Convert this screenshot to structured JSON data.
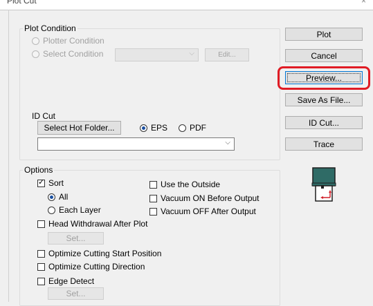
{
  "window": {
    "title": "Plot Cut",
    "close_glyph": "×"
  },
  "plot_condition": {
    "legend": "Plot Condition",
    "plotter_condition_label": "Plotter Condition",
    "select_condition_label": "Select Condition",
    "edit_label": "Edit..."
  },
  "id_cut": {
    "legend": "ID Cut",
    "select_hot_folder_label": "Select Hot Folder...",
    "eps_label": "EPS",
    "pdf_label": "PDF",
    "folder_value": ""
  },
  "options": {
    "legend": "Options",
    "sort_label": "Sort",
    "all_label": "All",
    "each_layer_label": "Each Layer",
    "head_withdrawal_label": "Head Withdrawal After Plot",
    "set_label_1": "Set...",
    "optimize_start_label": "Optimize Cutting Start Position",
    "optimize_direction_label": "Optimize Cutting Direction",
    "edge_detect_label": "Edge Detect",
    "set_label_2": "Set...",
    "use_outside_label": "Use the Outside",
    "vacuum_on_label": "Vacuum ON Before Output",
    "vacuum_off_label": "Vacuum OFF After Output"
  },
  "actions": {
    "plot_label": "Plot",
    "cancel_label": "Cancel",
    "preview_label": "Preview...",
    "save_as_file_label": "Save As File...",
    "id_cut_label": "ID Cut...",
    "trace_label": "Trace"
  },
  "colors": {
    "highlight": "#e01b24",
    "icon_teal": "#2f6b66",
    "icon_red": "#d0202a"
  }
}
